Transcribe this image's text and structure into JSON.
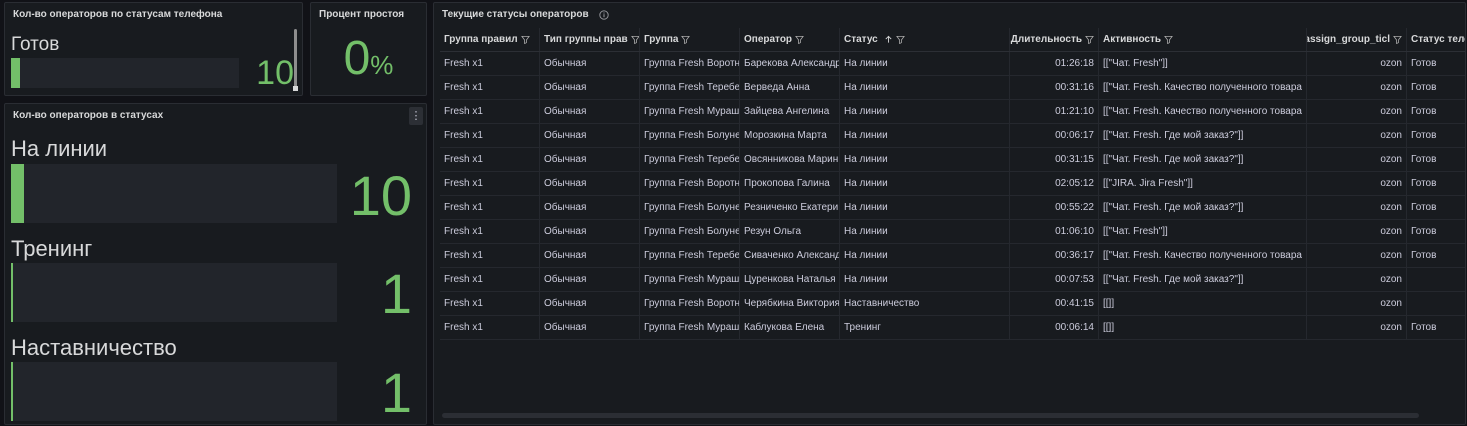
{
  "phone_panel": {
    "title": "Кол-во операторов по статусам телефона",
    "label": "Готов",
    "value": "10",
    "fill_fraction": 0.04
  },
  "idle_panel": {
    "title": "Процент простоя",
    "value": "0",
    "unit": "%"
  },
  "status_panel": {
    "title": "Кол-во операторов в статусах",
    "menu_icon": "kebab-menu-icon",
    "gauges": [
      {
        "label": "На линии",
        "value": "10",
        "fill_fraction": 0.045
      },
      {
        "label": "Тренинг",
        "value": "1",
        "fill_fraction": 0.005
      },
      {
        "label": "Наставничество",
        "value": "1",
        "fill_fraction": 0.005
      }
    ]
  },
  "table_panel": {
    "title": "Текущие статусы операторов",
    "info_icon": "info-icon",
    "sort_icon": "arrow-up-icon",
    "filter_icon": "funnel-icon",
    "columns": [
      "Группа правил",
      "Тип группы прав",
      "Группа",
      "Оператор",
      "Статус",
      "Длительность",
      "Активность",
      "assign_group_ticl",
      "Статус теле"
    ],
    "rows": [
      [
        "Fresh x1",
        "Обычная",
        "Группа Fresh Воротн",
        "Барекова Александр",
        "На линии",
        "01:26:18",
        "[[\"Чат. Fresh\"]]",
        "ozon",
        "Готов"
      ],
      [
        "Fresh x1",
        "Обычная",
        "Группа Fresh Теребе",
        "Верведа Анна",
        "На линии",
        "00:31:16",
        "[[\"Чат. Fresh. Качество полученного товара",
        "ozon",
        "Готов"
      ],
      [
        "Fresh x1",
        "Обычная",
        "Группа Fresh Мураш",
        "Зайцева Ангелина",
        "На линии",
        "01:21:10",
        "[[\"Чат. Fresh. Качество полученного товара",
        "ozon",
        "Готов"
      ],
      [
        "Fresh x1",
        "Обычная",
        "Группа Fresh Болуне",
        "Морозкина Марта",
        "На линии",
        "00:06:17",
        "[[\"Чат. Fresh. Где мой заказ?\"]]",
        "ozon",
        "Готов"
      ],
      [
        "Fresh x1",
        "Обычная",
        "Группа Fresh Теребе",
        "Овсянникова Марин",
        "На линии",
        "00:31:15",
        "[[\"Чат. Fresh. Где мой заказ?\"]]",
        "ozon",
        "Готов"
      ],
      [
        "Fresh x1",
        "Обычная",
        "Группа Fresh Воротн",
        "Прокопова Галина",
        "На линии",
        "02:05:12",
        "[[\"JIRA. Jira Fresh\"]]",
        "ozon",
        "Готов"
      ],
      [
        "Fresh x1",
        "Обычная",
        "Группа Fresh Болуне",
        "Резниченко Екатери",
        "На линии",
        "00:55:22",
        "[[\"Чат. Fresh. Где мой заказ?\"]]",
        "ozon",
        "Готов"
      ],
      [
        "Fresh x1",
        "Обычная",
        "Группа Fresh Болуне",
        "Резун Ольга",
        "На линии",
        "01:06:10",
        "[[\"Чат. Fresh\"]]",
        "ozon",
        "Готов"
      ],
      [
        "Fresh x1",
        "Обычная",
        "Группа Fresh Теребе",
        "Сиваченко Александ",
        "На линии",
        "00:36:17",
        "[[\"Чат. Fresh. Качество полученного товара",
        "ozon",
        "Готов"
      ],
      [
        "Fresh x1",
        "Обычная",
        "Группа Fresh Мураш",
        "Цуренкова Наталья",
        "На линии",
        "00:07:53",
        "[[\"Чат. Fresh. Где мой заказ?\"]]",
        "ozon",
        ""
      ],
      [
        "Fresh x1",
        "Обычная",
        "Группа Fresh Воротн",
        "Черябкина Виктория",
        "Наставничество",
        "00:41:15",
        "[[]]",
        "ozon",
        ""
      ],
      [
        "Fresh x1",
        "Обычная",
        "Группа Fresh Мураш",
        "Каблукова Елена",
        "Тренинг",
        "00:06:14",
        "[[]]",
        "ozon",
        "Готов"
      ]
    ]
  }
}
